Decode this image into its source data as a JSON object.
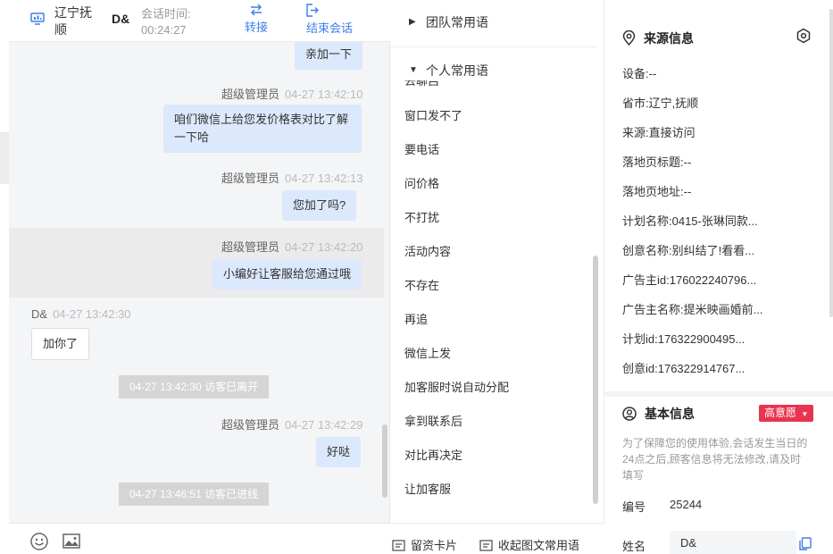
{
  "header": {
    "region": "辽宁抚顺",
    "user": "D&",
    "session_time_label": "会话时间:",
    "session_time": "00:24:27",
    "transfer_label": "转接",
    "end_label": "结束会话"
  },
  "messages": {
    "m1": {
      "text": "亲加一下"
    },
    "m2": {
      "sender": "超级管理员",
      "time": "04-27 13:42:10",
      "line1": "咱们微信上给您发价格表对比了解",
      "line2": "一下哈"
    },
    "m3": {
      "sender": "超级管理员",
      "time": "04-27 13:42:13",
      "text": "您加了吗?"
    },
    "m4": {
      "sender": "超级管理员",
      "time": "04-27 13:42:20",
      "text": "小编好让客服给您通过哦"
    },
    "m5": {
      "sender": "D&",
      "time": "04-27 13:42:30",
      "text": "加你了"
    },
    "sys1": "04-27 13:42:30 访客已离开",
    "m6": {
      "sender": "超级管理员",
      "time": "04-27 13:42:29",
      "text": "好哒"
    },
    "sys2": "04-27 13:46:51 访客已进线"
  },
  "toolbar": {
    "emoji_icon": "smile-icon",
    "image_icon": "image-icon"
  },
  "phrases": {
    "team_group": "团队常用语",
    "personal_group": "个人常用语",
    "clipped_item": "去聊吕",
    "items": [
      "窗口发不了",
      "要电话",
      "问价格",
      "不打扰",
      "活动内容",
      "不存在",
      "再追",
      "微信上发",
      "加客服时说自动分配",
      "拿到联系后",
      "对比再决定",
      "让加客服"
    ],
    "leave_card": "留资卡片",
    "collapse": "收起图文常用语"
  },
  "source_info": {
    "title": "来源信息",
    "device": "设备:--",
    "province": "省市:辽宁,抚顺",
    "source": "来源:直接访问",
    "landing_title": "落地页标题:--",
    "landing_url": "落地页地址:--",
    "plan_name": "计划名称:0415-张琳同款...",
    "creative_name": "创意名称:别纠结了!看看...",
    "advertiser_id": "广告主id:176022240796...",
    "advertiser_name": "广告主名称:提米映画婚前...",
    "plan_id": "计划id:176322900495...",
    "creative_id": "创意id:176322914767..."
  },
  "basic_info": {
    "title": "基本信息",
    "intent_badge": "高意愿",
    "notice": "为了保障您的使用体验,会话发生当日的24点之后,顾客信息将无法修改,请及时填写",
    "id_label": "编号",
    "id_value": "25244",
    "name_label": "姓名",
    "name_value": "D&"
  },
  "colors": {
    "accent": "#3d7ee8",
    "agent_bubble": "#dce8fb",
    "intent_badge": "#e8344e"
  }
}
